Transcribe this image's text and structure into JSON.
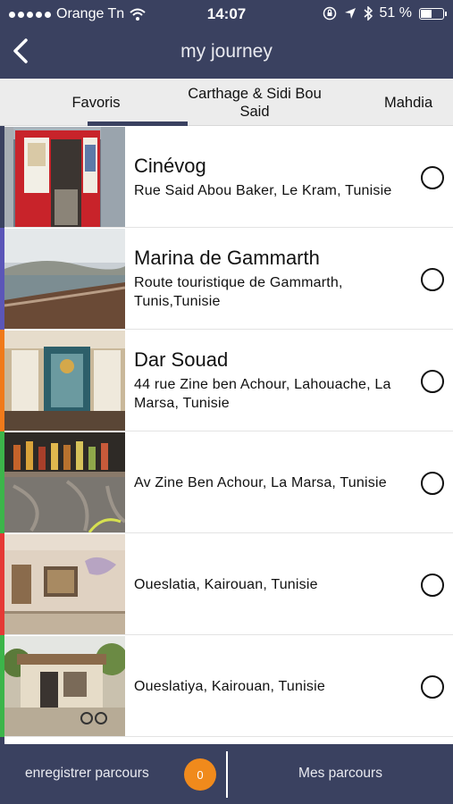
{
  "status_bar": {
    "carrier": "Orange Tn",
    "time": "14:07",
    "battery": "51 %",
    "battery_level": 0.51,
    "icons": [
      "signal-dots-icon",
      "wifi-icon",
      "lock-rotation-icon",
      "location-arrow-icon",
      "bluetooth-icon",
      "battery-icon"
    ]
  },
  "navbar": {
    "title": "my journey",
    "back_icon": "chevron-left-icon"
  },
  "tabs": [
    {
      "label": "Favoris",
      "selected": true
    },
    {
      "label": "Carthage & Sidi Bou Said",
      "selected": false
    },
    {
      "label": "Mahdia",
      "selected": false
    }
  ],
  "places": [
    {
      "name": "Cinévog",
      "address": "Rue Said Abou Baker, Le Kram, Tunisie",
      "stripe_color": "#3a4160",
      "selected": false
    },
    {
      "name": "Marina de Gammarth",
      "address": "Route touristique de Gammarth, Tunis,Tunisie",
      "stripe_color": "#5b56b8",
      "selected": false
    },
    {
      "name": "Dar Souad",
      "address": "44 rue Zine ben Achour, Lahouache, La Marsa, Tunisie",
      "stripe_color": "#f07a1a",
      "selected": false
    },
    {
      "name": "",
      "address": "Av Zine Ben Achour,  La Marsa, Tunisie",
      "stripe_color": "#3cb54a",
      "selected": false
    },
    {
      "name": "",
      "address": "Oueslatia, Kairouan, Tunisie",
      "stripe_color": "#e53935",
      "selected": false
    },
    {
      "name": "",
      "address": "Oueslatiya, Kairouan, Tunisie",
      "stripe_color": "#3cb54a",
      "selected": false
    }
  ],
  "footer": {
    "save_label": "enregistrer parcours",
    "count": "0",
    "my_routes_label": "Mes parcours",
    "badge_color": "#f08a1c"
  },
  "colors": {
    "primary": "#3a4160",
    "tab_background": "#ececec"
  }
}
